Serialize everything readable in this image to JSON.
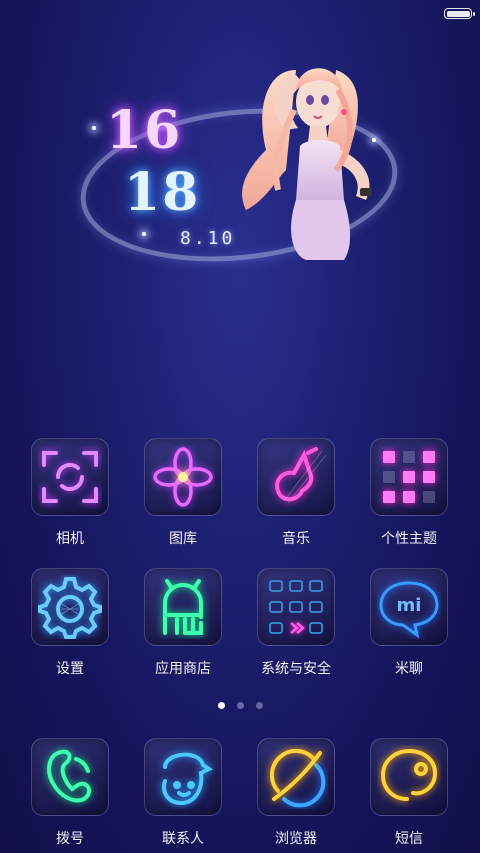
{
  "status_bar": {
    "battery_level": 1.0
  },
  "clock_widget": {
    "hour": "16",
    "minute": "18",
    "date": "8.10"
  },
  "pages": {
    "count": 3,
    "active_index": 0
  },
  "apps": [
    {
      "label": "相机",
      "icon": "camera-icon"
    },
    {
      "label": "图库",
      "icon": "gallery-icon"
    },
    {
      "label": "音乐",
      "icon": "music-icon"
    },
    {
      "label": "个性主题",
      "icon": "themes-icon"
    },
    {
      "label": "设置",
      "icon": "settings-icon"
    },
    {
      "label": "应用商店",
      "icon": "app-store-icon"
    },
    {
      "label": "系统与安全",
      "icon": "security-icon"
    },
    {
      "label": "米聊",
      "icon": "mitalk-icon"
    }
  ],
  "dock": [
    {
      "label": "拨号",
      "icon": "phone-icon"
    },
    {
      "label": "联系人",
      "icon": "contacts-icon"
    },
    {
      "label": "浏览器",
      "icon": "browser-icon"
    },
    {
      "label": "短信",
      "icon": "sms-icon"
    }
  ],
  "colors": {
    "background": "#1c1f6e",
    "neon_purple": "#c86bff",
    "neon_pink": "#ff5cf0",
    "neon_blue": "#5fc8ff",
    "neon_green": "#3dffb0",
    "neon_yellow": "#ffd23a"
  }
}
